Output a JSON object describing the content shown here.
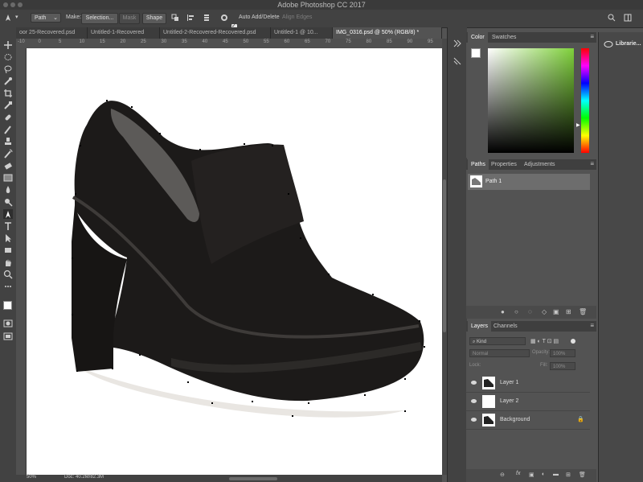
{
  "app": {
    "title": "Adobe Photoshop CC 2017"
  },
  "options_bar": {
    "mode_value": "Path",
    "make_label": "Make:",
    "selection_label": "Selection...",
    "mask_label": "Mask",
    "shape_label": "Shape",
    "auto_add_delete_label": "Auto Add/Delete",
    "auto_add_delete_checked": true,
    "align_edges_label": "Align Edges"
  },
  "tabs": [
    {
      "label": "oor 25-Recovered.psd"
    },
    {
      "label": "Untitled-1-Recovered"
    },
    {
      "label": "Untitled-2-Recovered-Recovered.psd"
    },
    {
      "label": "Untitled-1 @ 10..."
    },
    {
      "label": "IMG_0316.psd @ 50% (RGB/8) *"
    }
  ],
  "ruler_numbers": [
    "-10",
    "0",
    "5",
    "10",
    "15",
    "20",
    "25",
    "30",
    "35",
    "40",
    "45",
    "50",
    "55",
    "60",
    "65",
    "70",
    "75",
    "80",
    "85",
    "90",
    "95"
  ],
  "status": {
    "zoom": "50%",
    "doc": "Doc: 40.2M/82.3M"
  },
  "color_panel": {
    "tabs": [
      "Color",
      "Swatches"
    ],
    "hue_color": "#7fd13b"
  },
  "paths_panel": {
    "tabs": [
      "Paths",
      "Properties",
      "Adjustments"
    ],
    "items": [
      {
        "name": "Path 1"
      }
    ]
  },
  "layers_panel": {
    "tabs": [
      "Layers",
      "Channels"
    ],
    "filter_kind": "Kind",
    "blend_mode": "Normal",
    "opacity_label": "Opacity:",
    "opacity_value": "100%",
    "lock_label": "Lock:",
    "fill_label": "Fill:",
    "fill_value": "100%",
    "layers": [
      {
        "name": "Layer 1"
      },
      {
        "name": "Layer 2"
      },
      {
        "name": "Background"
      }
    ]
  },
  "libraries": {
    "label": "Librarie..."
  }
}
